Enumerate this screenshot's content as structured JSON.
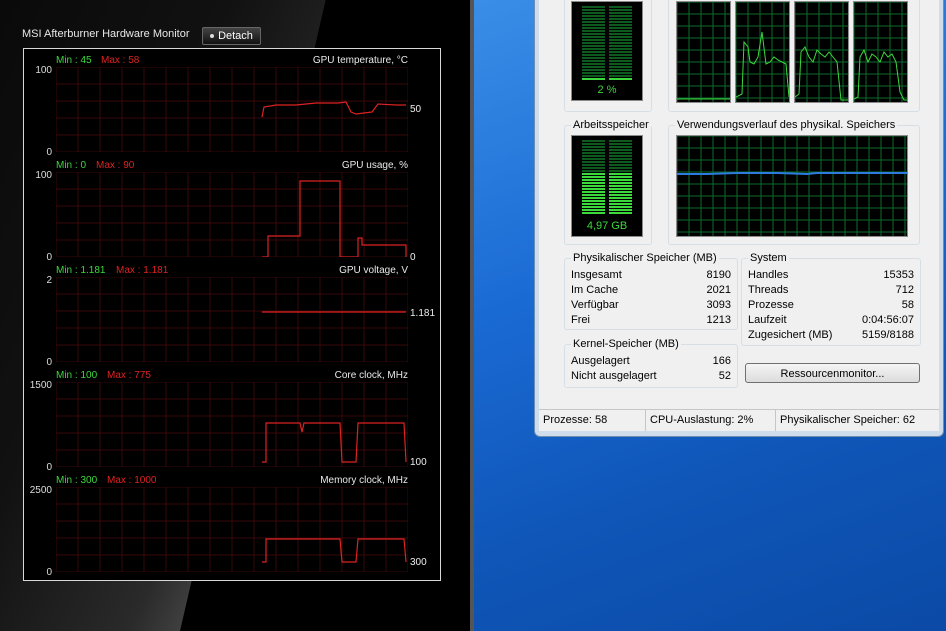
{
  "msi": {
    "title": "MSI Afterburner Hardware Monitor",
    "detach_label": "Detach",
    "graphs": [
      {
        "title": "GPU temperature, °C",
        "min_label": "Min : 45",
        "max_label": "Max : 58",
        "y_max": "100",
        "y_min": "0",
        "current": "50"
      },
      {
        "title": "GPU usage, %",
        "min_label": "Min : 0",
        "max_label": "Max : 90",
        "y_max": "100",
        "y_min": "0",
        "current": "0"
      },
      {
        "title": "GPU voltage, V",
        "min_label": "Min : 1.181",
        "max_label": "Max : 1.181",
        "y_max": "2",
        "y_min": "0",
        "current": "1.181"
      },
      {
        "title": "Core clock, MHz",
        "min_label": "Min : 100",
        "max_label": "Max : 775",
        "y_max": "1500",
        "y_min": "0",
        "current": "100"
      },
      {
        "title": "Memory clock, MHz",
        "min_label": "Min : 300",
        "max_label": "Max : 1000",
        "y_max": "2500",
        "y_min": "0",
        "current": "300"
      }
    ]
  },
  "taskmanager": {
    "cpu_usage_value": "2 %",
    "memory_label": "Arbeitsspeicher",
    "memory_value": "4,97 GB",
    "memory_history_label": "Verwendungsverlauf des physikal. Speichers",
    "physical": {
      "label": "Physikalischer Speicher (MB)",
      "rows": [
        {
          "key": "Insgesamt",
          "value": "8190"
        },
        {
          "key": "Im Cache",
          "value": "2021"
        },
        {
          "key": "Verfügbar",
          "value": "3093"
        },
        {
          "key": "Frei",
          "value": "1213"
        }
      ]
    },
    "kernel": {
      "label": "Kernel-Speicher (MB)",
      "rows": [
        {
          "key": "Ausgelagert",
          "value": "166"
        },
        {
          "key": "Nicht ausgelagert",
          "value": "52"
        }
      ]
    },
    "system": {
      "label": "System",
      "rows": [
        {
          "key": "Handles",
          "value": "15353"
        },
        {
          "key": "Threads",
          "value": "712"
        },
        {
          "key": "Prozesse",
          "value": "58"
        },
        {
          "key": "Laufzeit",
          "value": "0:04:56:07"
        },
        {
          "key": "Zugesichert (MB)",
          "value": "5159/8188"
        }
      ]
    },
    "resource_monitor_label": "Ressourcenmonitor...",
    "status": {
      "processes": "Prozesse: 58",
      "cpu": "CPU-Auslastung: 2%",
      "memory": "Physikalischer Speicher: 62"
    }
  },
  "colors": {
    "graph_line": "#dd2222",
    "graph_grid": "#3a0808",
    "tm_grid": "#0b6b2a",
    "tm_line": "#3cd93c",
    "memory_line": "#2e7be0"
  }
}
